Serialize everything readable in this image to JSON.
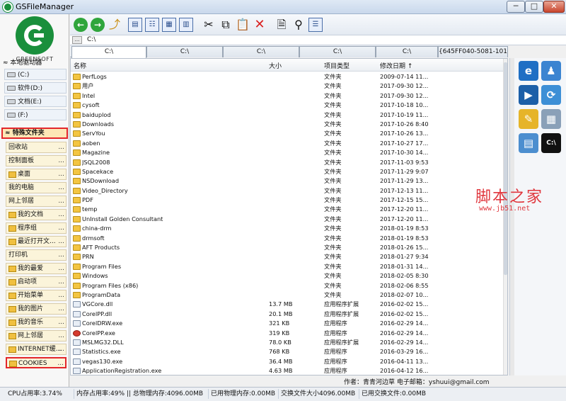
{
  "window": {
    "title": "GSFileManager",
    "minimize": "─",
    "maximize": "□",
    "close": "✕"
  },
  "logo": {
    "text": "GREENSOFT"
  },
  "local_drives": {
    "header": "本地驱动器",
    "items": [
      "(C:)",
      "软件(D:)",
      "文档(E:)",
      "(F:)"
    ]
  },
  "special_folders": {
    "header": "特殊文件夹",
    "items": [
      {
        "label": "回收站",
        "icon": ""
      },
      {
        "label": "控制面板",
        "icon": ""
      },
      {
        "label": "桌面",
        "icon": "desktop-icon"
      },
      {
        "label": "我的电脑",
        "icon": ""
      },
      {
        "label": "网上邻居",
        "icon": ""
      },
      {
        "label": "我的文档",
        "icon": "folder-icon"
      },
      {
        "label": "程序组",
        "icon": "folder-icon"
      },
      {
        "label": "最近打开文...",
        "icon": "recent-icon"
      },
      {
        "label": "打印机",
        "icon": ""
      },
      {
        "label": "我的最爱",
        "icon": "folder-icon"
      },
      {
        "label": "启动项",
        "icon": "folder-icon"
      },
      {
        "label": "开始菜单",
        "icon": "folder-icon"
      },
      {
        "label": "我的图片",
        "icon": "folder-icon"
      },
      {
        "label": "我的音乐",
        "icon": "folder-icon"
      },
      {
        "label": "网上邻居",
        "icon": "network-icon"
      },
      {
        "label": "INTERNET缓...",
        "icon": "folder-icon"
      },
      {
        "label": "COOKIES",
        "icon": "folder-icon"
      }
    ],
    "more": "..."
  },
  "address": {
    "button": "...",
    "path": "C:\\"
  },
  "tabs": [
    "C:\\",
    "C:\\",
    "C:\\",
    "C:\\",
    "C:\\",
    "{645FF040-5081-101B-9F0"
  ],
  "columns": {
    "name": "名称",
    "size": "大小",
    "type": "项目类型",
    "date": "修改日期 ↑"
  },
  "files": [
    {
      "name": "PerfLogs",
      "size": "",
      "type": "文件夹",
      "date": "2009-07-14 11...",
      "kind": "folder"
    },
    {
      "name": "用户",
      "size": "",
      "type": "文件夹",
      "date": "2017-09-30 12...",
      "kind": "folder"
    },
    {
      "name": "Intel",
      "size": "",
      "type": "文件夹",
      "date": "2017-09-30 12...",
      "kind": "folder"
    },
    {
      "name": "cysoft",
      "size": "",
      "type": "文件夹",
      "date": "2017-10-18 10...",
      "kind": "folder"
    },
    {
      "name": "baiduplod",
      "size": "",
      "type": "文件夹",
      "date": "2017-10-19 11...",
      "kind": "folder"
    },
    {
      "name": "Downloads",
      "size": "",
      "type": "文件夹",
      "date": "2017-10-26 8:40",
      "kind": "folder"
    },
    {
      "name": "ServYou",
      "size": "",
      "type": "文件夹",
      "date": "2017-10-26 13...",
      "kind": "folder"
    },
    {
      "name": "aoben",
      "size": "",
      "type": "文件夹",
      "date": "2017-10-27 17...",
      "kind": "folder"
    },
    {
      "name": "Magazine",
      "size": "",
      "type": "文件夹",
      "date": "2017-10-30 14...",
      "kind": "folder"
    },
    {
      "name": "JSQL2008",
      "size": "",
      "type": "文件夹",
      "date": "2017-11-03 9:53",
      "kind": "folder"
    },
    {
      "name": "Spacekace",
      "size": "",
      "type": "文件夹",
      "date": "2017-11-29 9:07",
      "kind": "folder"
    },
    {
      "name": "NSDownload",
      "size": "",
      "type": "文件夹",
      "date": "2017-11-29 13...",
      "kind": "folder"
    },
    {
      "name": "Video_Directory",
      "size": "",
      "type": "文件夹",
      "date": "2017-12-13 11...",
      "kind": "folder"
    },
    {
      "name": "PDF",
      "size": "",
      "type": "文件夹",
      "date": "2017-12-15 15...",
      "kind": "folder"
    },
    {
      "name": "temp",
      "size": "",
      "type": "文件夹",
      "date": "2017-12-20 11...",
      "kind": "folder"
    },
    {
      "name": "UnInstall Golden Consultant",
      "size": "",
      "type": "文件夹",
      "date": "2017-12-20 11...",
      "kind": "folder"
    },
    {
      "name": "china-drm",
      "size": "",
      "type": "文件夹",
      "date": "2018-01-19 8:53",
      "kind": "folder"
    },
    {
      "name": "drmsoft",
      "size": "",
      "type": "文件夹",
      "date": "2018-01-19 8:53",
      "kind": "folder"
    },
    {
      "name": "AFT Products",
      "size": "",
      "type": "文件夹",
      "date": "2018-01-26 15...",
      "kind": "folder"
    },
    {
      "name": "PRN",
      "size": "",
      "type": "文件夹",
      "date": "2018-01-27 9:34",
      "kind": "folder"
    },
    {
      "name": "Program Files",
      "size": "",
      "type": "文件夹",
      "date": "2018-01-31 14...",
      "kind": "folder"
    },
    {
      "name": "Windows",
      "size": "",
      "type": "文件夹",
      "date": "2018-02-05 8:30",
      "kind": "folder"
    },
    {
      "name": "Program Files (x86)",
      "size": "",
      "type": "文件夹",
      "date": "2018-02-06 8:55",
      "kind": "folder"
    },
    {
      "name": "ProgramData",
      "size": "",
      "type": "文件夹",
      "date": "2018-02-07 10...",
      "kind": "folder"
    },
    {
      "name": "VGCore.dll",
      "size": "13.7 MB",
      "type": "应用程序扩展",
      "date": "2016-02-02 15...",
      "kind": "file"
    },
    {
      "name": "CorelPP.dll",
      "size": "20.1 MB",
      "type": "应用程序扩展",
      "date": "2016-02-02 15...",
      "kind": "file"
    },
    {
      "name": "CorelDRW.exe",
      "size": "321 KB",
      "type": "应用程序",
      "date": "2016-02-29 14...",
      "kind": "file"
    },
    {
      "name": "CorelPP.exe",
      "size": "319 KB",
      "type": "应用程序",
      "date": "2016-02-29 14...",
      "kind": "exe"
    },
    {
      "name": "MSLMG32.DLL",
      "size": "78.0 KB",
      "type": "应用程序扩展",
      "date": "2016-02-29 14...",
      "kind": "file"
    },
    {
      "name": "Statistics.exe",
      "size": "768 KB",
      "type": "应用程序",
      "date": "2016-03-29 16...",
      "kind": "file"
    },
    {
      "name": "vegas130.exe",
      "size": "36.4 MB",
      "type": "应用程序",
      "date": "2016-04-11 13...",
      "kind": "file"
    },
    {
      "name": "ApplicationRegistration.exe",
      "size": "4.63 MB",
      "type": "应用程序",
      "date": "2016-04-12 16...",
      "kind": "file"
    }
  ],
  "watermark": {
    "line1": "脚本之家",
    "line2": "www.jb51.net"
  },
  "author": "作者：青青河边草 电子邮箱：yshuui@gmail.com",
  "status": {
    "cpu": "CPU占用率:3.74%",
    "mem": "内存占用率:49% || 总物理内存:4096.00MB",
    "used_phys": "已用物理内存:0.00MB",
    "swap": "交换文件大小4096.00MB",
    "used_swap": "已用交换文件:0.00MB"
  }
}
